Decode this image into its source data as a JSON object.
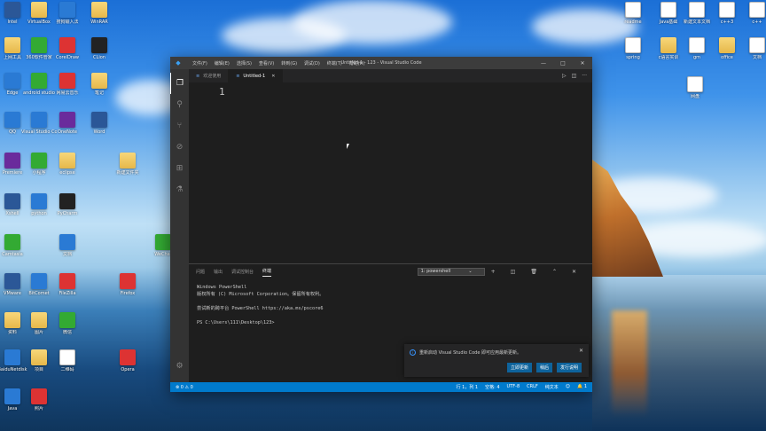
{
  "desktop": {
    "left_icons": [
      {
        "label": "Intel",
        "color": "#2b5797",
        "type": "word"
      },
      {
        "label": "VirtualBox",
        "color": "#e6b84a",
        "type": "folder"
      },
      {
        "label": "搜狗输入法",
        "color": "#2a7ad4",
        "type": "vs"
      },
      {
        "label": "WinRAR",
        "color": "#e6b84a",
        "type": "folder"
      },
      {
        "label": "上网工具",
        "color": "#e6b84a",
        "type": "folder"
      },
      {
        "label": "360软件管家",
        "color": "#3a3",
        "type": "green"
      },
      {
        "label": "CorelDraw",
        "color": "#d33",
        "type": "red"
      },
      {
        "label": "CLion",
        "color": "#222",
        "type": "dark"
      },
      {
        "label": "Edge",
        "color": "#2a7ad4",
        "type": "vs"
      },
      {
        "label": "android studio",
        "color": "#3a3",
        "type": "green"
      },
      {
        "label": "网易云音乐",
        "color": "#d33",
        "type": "red"
      },
      {
        "label": "笔记",
        "color": "#e6b84a",
        "type": "folder"
      },
      {
        "label": "QQ",
        "color": "#2a7ad4",
        "type": "vs"
      },
      {
        "label": "Visual Studio Code",
        "color": "#2a7ad4",
        "type": "vs"
      },
      {
        "label": "OneNote",
        "color": "#6a2b9c",
        "type": "purple"
      },
      {
        "label": "Word",
        "color": "#2b5797",
        "type": "word"
      },
      {
        "label": "Premiere",
        "color": "#6a2b9c",
        "type": "purple"
      },
      {
        "label": "小程序",
        "color": "#3a3",
        "type": "green"
      },
      {
        "label": "eclipse",
        "color": "#e6b84a",
        "type": "folder"
      },
      {
        "label": "新建文件夹",
        "color": "#e6b84a",
        "type": "folder"
      },
      {
        "label": "Xshell",
        "color": "#2b5797",
        "type": "word"
      },
      {
        "label": "python",
        "color": "#2a7ad4",
        "type": "vs"
      },
      {
        "label": "PyCharm",
        "color": "#222",
        "type": "dark"
      },
      {
        "label": "Camtasia",
        "color": "#3a3",
        "type": "green"
      },
      {
        "label": "文档",
        "color": "#2a7ad4",
        "type": "vs"
      },
      {
        "label": "WeChat",
        "color": "#3a3",
        "type": "green"
      },
      {
        "label": "VMware",
        "color": "#2b5797",
        "type": "word"
      },
      {
        "label": "BitComet",
        "color": "#2a7ad4",
        "type": "vs"
      },
      {
        "label": "FileZilla",
        "color": "#d33",
        "type": "red"
      },
      {
        "label": "Firefox",
        "color": "#d33",
        "type": "red"
      },
      {
        "label": "资料",
        "color": "#e6b84a",
        "type": "folder"
      },
      {
        "label": "图片",
        "color": "#e6b84a",
        "type": "folder"
      },
      {
        "label": "微信",
        "color": "#3a3",
        "type": "green"
      },
      {
        "label": "BaiduNetdisk",
        "color": "#2a7ad4",
        "type": "vs"
      },
      {
        "label": "项目",
        "color": "#e6b84a",
        "type": "folder"
      },
      {
        "label": "二维码",
        "color": "#aaa",
        "type": "doc"
      },
      {
        "label": "Opera",
        "color": "#d33",
        "type": "red"
      },
      {
        "label": "Java",
        "color": "#2a7ad4",
        "type": "vs"
      },
      {
        "label": "照片",
        "color": "#d33",
        "type": "red"
      }
    ],
    "right_icons": [
      {
        "label": "readme",
        "type": "doc"
      },
      {
        "label": "Java基础",
        "type": "doc"
      },
      {
        "label": "新建文本文档",
        "type": "doc"
      },
      {
        "label": "c++3",
        "type": "doc"
      },
      {
        "label": "c++",
        "type": "doc"
      },
      {
        "label": "spring",
        "type": "doc"
      },
      {
        "label": "c语言实训",
        "type": "folder"
      },
      {
        "label": "gm",
        "type": "doc"
      },
      {
        "label": "office",
        "type": "folder"
      },
      {
        "label": "文档",
        "type": "doc"
      },
      {
        "label": "网盘",
        "type": "doc"
      }
    ]
  },
  "window": {
    "title": "Untitled-1 - 123 - Visual Studio Code",
    "menu": [
      "文件(F)",
      "编辑(E)",
      "选择(S)",
      "查看(V)",
      "转到(G)",
      "调试(D)",
      "终端(T)",
      "帮助(H)"
    ],
    "controls": {
      "minimize": "—",
      "maximize": "□",
      "close": "✕"
    }
  },
  "activity_bar": [
    "files-icon",
    "search-icon",
    "source-control-icon",
    "debug-icon",
    "extensions-icon",
    "flask-icon"
  ],
  "tabs": [
    {
      "label": "欢迎使用",
      "active": false,
      "icon": "≡"
    },
    {
      "label": "Untitled-1",
      "active": true,
      "icon": "≡"
    }
  ],
  "tab_actions": {
    "run": "▷",
    "split": "◫",
    "more": "···"
  },
  "editor": {
    "line_number": "1"
  },
  "panel": {
    "tabs": [
      "问题",
      "输出",
      "调试控制台",
      "终端"
    ],
    "active_tab": "终端",
    "terminal_select": "1: powershell",
    "terminal_lines": [
      "Windows PowerShell",
      "版权所有 (C) Microsoft Corporation。保留所有权利。",
      "",
      "尝试新的跨平台 PowerShell https://aka.ms/pscore6",
      "",
      "PS C:\\Users\\111\\Desktop\\123>"
    ],
    "actions": {
      "add": "+",
      "split": "◫",
      "kill": "🗑",
      "maximize": "⌃",
      "close": "✕"
    }
  },
  "notification": {
    "message": "重新启动 Visual Studio Code 即可应用最新更新。",
    "buttons": [
      "立即更新",
      "稍后",
      "发行说明"
    ],
    "close": "✕"
  },
  "statusbar": {
    "left": "⊗ 0 ⚠ 0",
    "items": [
      "行 1，列 1",
      "空格: 4",
      "UTF-8",
      "CRLF",
      "纯文本",
      "☺",
      "🔔 1"
    ]
  }
}
